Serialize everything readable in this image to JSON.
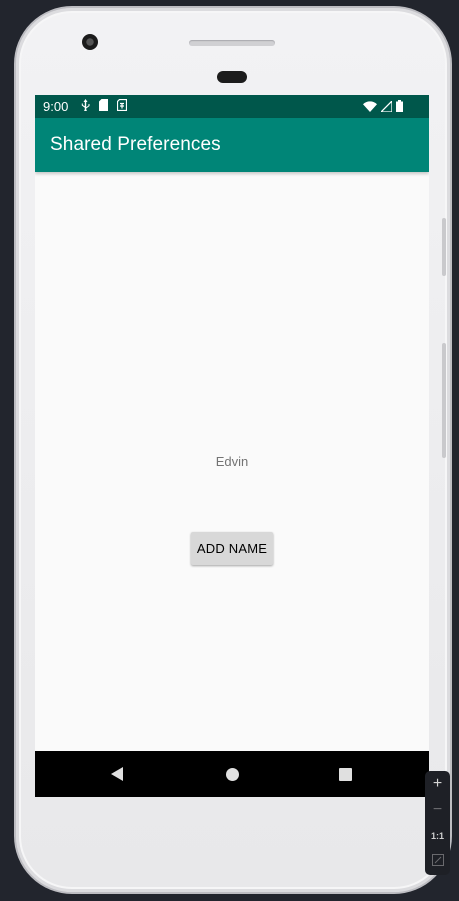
{
  "status_bar": {
    "time": "9:00",
    "left_icons": [
      "usb-debug-icon",
      "sd-card-icon",
      "sim-icon"
    ],
    "right_icons": [
      "wifi-icon",
      "cell-signal-icon",
      "battery-icon"
    ]
  },
  "app_bar": {
    "title": "Shared Preferences"
  },
  "main": {
    "name_text": "Edvin",
    "add_button_label": "ADD NAME"
  },
  "nav_bar": {
    "icons": [
      "back-icon",
      "home-icon",
      "recent-apps-icon"
    ]
  },
  "emulator_toolbar": {
    "zoom_in": "+",
    "zoom_out": "−",
    "actual_size": "1:1"
  },
  "colors": {
    "status_bar": "#00574b",
    "app_bar": "#008577",
    "screen_bg": "#fafafa",
    "button_bg": "#d8d8d8"
  }
}
